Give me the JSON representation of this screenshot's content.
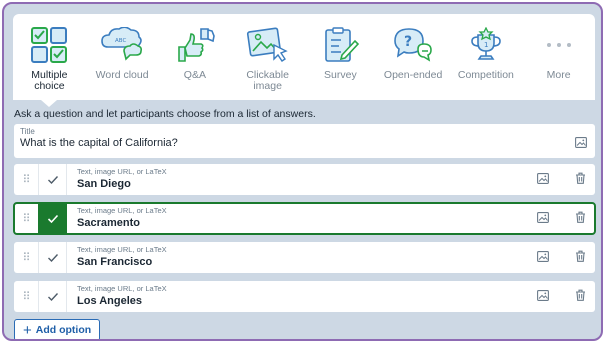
{
  "question_types": [
    {
      "label": "Multiple choice",
      "icon": "multiple-choice-icon",
      "active": true
    },
    {
      "label": "Word cloud",
      "icon": "word-cloud-icon",
      "active": false
    },
    {
      "label": "Q&A",
      "icon": "qa-thumbs-icon",
      "active": false
    },
    {
      "label": "Clickable image",
      "icon": "clickable-image-icon",
      "active": false
    },
    {
      "label": "Survey",
      "icon": "survey-icon",
      "active": false
    },
    {
      "label": "Open-ended",
      "icon": "open-ended-icon",
      "active": false
    },
    {
      "label": "Competition",
      "icon": "trophy-icon",
      "active": false
    },
    {
      "label": "More",
      "icon": "more-dots-icon",
      "active": false
    }
  ],
  "hint": "Ask a question and let participants choose from a list of answers.",
  "title": {
    "caption": "Title",
    "value": "What is the capital of California?"
  },
  "options": [
    {
      "caption": "Text, image URL, or LaTeX",
      "value": "San Diego",
      "correct": false
    },
    {
      "caption": "Text, image URL, or LaTeX",
      "value": "Sacramento",
      "correct": true
    },
    {
      "caption": "Text, image URL, or LaTeX",
      "value": "San Francisco",
      "correct": false
    },
    {
      "caption": "Text, image URL, or LaTeX",
      "value": "Los Angeles",
      "correct": false
    }
  ],
  "add_option_label": "Add option",
  "colors": {
    "frame_border": "#8e6bb3",
    "background": "#cdd8e4",
    "correct": "#1a7a2e",
    "accent": "#1f5fa8",
    "icon_green": "#2aa84a",
    "icon_blue": "#3b7dbf",
    "icon_light": "#d7ecf7"
  }
}
